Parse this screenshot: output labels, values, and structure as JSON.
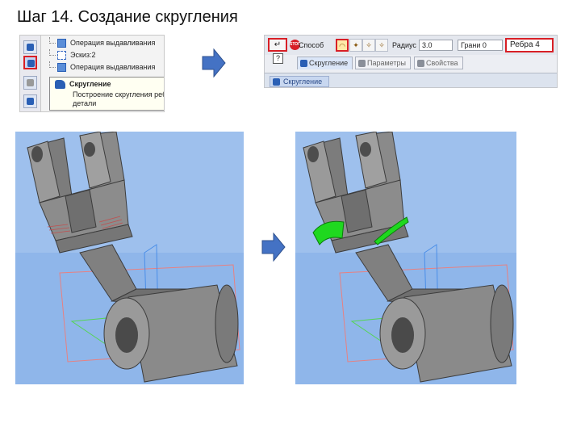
{
  "slide": {
    "title": "Шаг 14. Создание скругления"
  },
  "tree_panel": {
    "items": [
      {
        "label": "Операция выдавливания",
        "icon": "extrude-icon"
      },
      {
        "label": "Эскиз:2",
        "icon": "sketch-icon"
      },
      {
        "label": "Операция выдавливания",
        "icon": "extrude-icon"
      }
    ],
    "tooltip": {
      "title": "Скругление",
      "description": "Построение скругления ребра детали"
    }
  },
  "toolbar": {
    "enter_label": "↵",
    "stop_label": "STOP",
    "method_label": "Способ",
    "radius_label": "Радиус",
    "radius_value": "3.0",
    "faces_value": "Грани 0",
    "edges_value": "Ребра 4",
    "tabs": [
      "Скругление",
      "Параметры",
      "Свойства"
    ],
    "bottom_tab": "Скругление"
  },
  "colors": {
    "accent_red": "#d81f26",
    "arrow_blue": "#4472c4",
    "viewport_bg": "#8fb6ea",
    "fillet_green": "#1fd81f",
    "part_gray": "#8a8a8a"
  }
}
